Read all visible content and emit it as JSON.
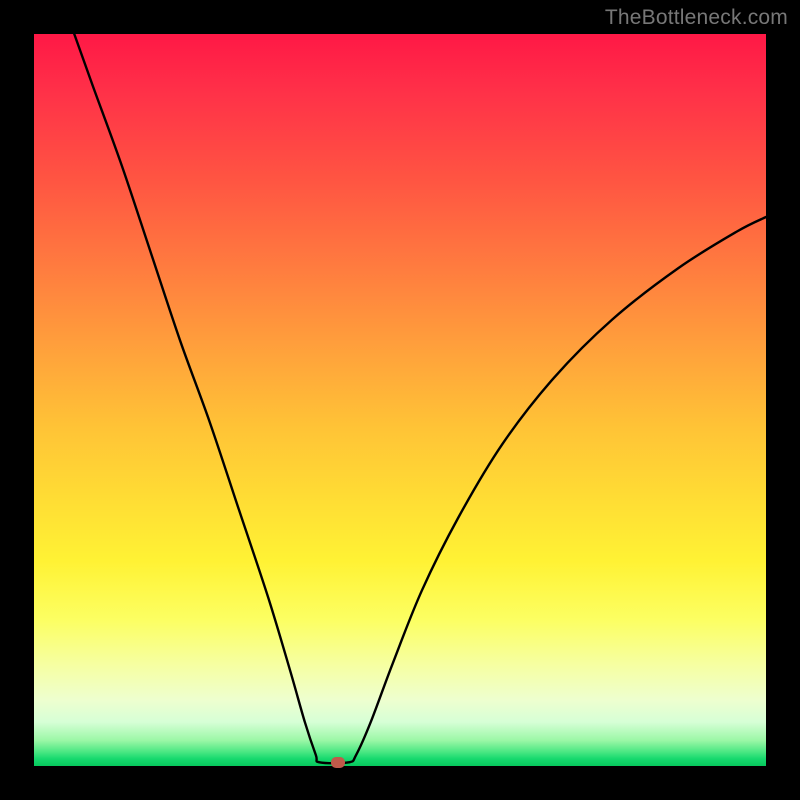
{
  "watermark": "TheBottleneck.com",
  "colors": {
    "frame": "#000000",
    "curve": "#000000",
    "marker": "#c05a4a",
    "gradient_stops": [
      {
        "pct": 0,
        "hex": "#ff1846"
      },
      {
        "pct": 8,
        "hex": "#ff3148"
      },
      {
        "pct": 20,
        "hex": "#ff5542"
      },
      {
        "pct": 32,
        "hex": "#ff7c3f"
      },
      {
        "pct": 44,
        "hex": "#ffa43b"
      },
      {
        "pct": 54,
        "hex": "#ffc436"
      },
      {
        "pct": 64,
        "hex": "#ffde34"
      },
      {
        "pct": 72,
        "hex": "#fff234"
      },
      {
        "pct": 80,
        "hex": "#fcff62"
      },
      {
        "pct": 86,
        "hex": "#f6ffa0"
      },
      {
        "pct": 91,
        "hex": "#eeffcf"
      },
      {
        "pct": 94,
        "hex": "#d6ffd6"
      },
      {
        "pct": 96.5,
        "hex": "#9bf7a6"
      },
      {
        "pct": 98,
        "hex": "#4ee884"
      },
      {
        "pct": 99,
        "hex": "#17d96e"
      },
      {
        "pct": 100,
        "hex": "#07c95d"
      }
    ]
  },
  "chart_data": {
    "type": "line",
    "title": "",
    "xlabel": "",
    "ylabel": "",
    "x_range": [
      0,
      100
    ],
    "y_range": [
      0,
      100
    ],
    "marker": {
      "x_pct": 41.5,
      "y_pct": 0
    },
    "series": [
      {
        "name": "bottleneck-curve",
        "comment": "y as percent of plot height (0 at bottom, 100 at top), x as percent of plot width",
        "points": [
          {
            "x": 5.5,
            "y": 100
          },
          {
            "x": 8,
            "y": 93
          },
          {
            "x": 12,
            "y": 82
          },
          {
            "x": 16,
            "y": 70
          },
          {
            "x": 20,
            "y": 58
          },
          {
            "x": 24,
            "y": 47
          },
          {
            "x": 28,
            "y": 35
          },
          {
            "x": 32,
            "y": 23
          },
          {
            "x": 35,
            "y": 13
          },
          {
            "x": 37,
            "y": 6
          },
          {
            "x": 38.5,
            "y": 1.5
          },
          {
            "x": 39,
            "y": 0.5
          },
          {
            "x": 43,
            "y": 0.5
          },
          {
            "x": 44,
            "y": 1.5
          },
          {
            "x": 46,
            "y": 6
          },
          {
            "x": 49,
            "y": 14
          },
          {
            "x": 53,
            "y": 24
          },
          {
            "x": 58,
            "y": 34
          },
          {
            "x": 64,
            "y": 44
          },
          {
            "x": 71,
            "y": 53
          },
          {
            "x": 79,
            "y": 61
          },
          {
            "x": 88,
            "y": 68
          },
          {
            "x": 96,
            "y": 73
          },
          {
            "x": 100,
            "y": 75
          }
        ]
      }
    ]
  }
}
